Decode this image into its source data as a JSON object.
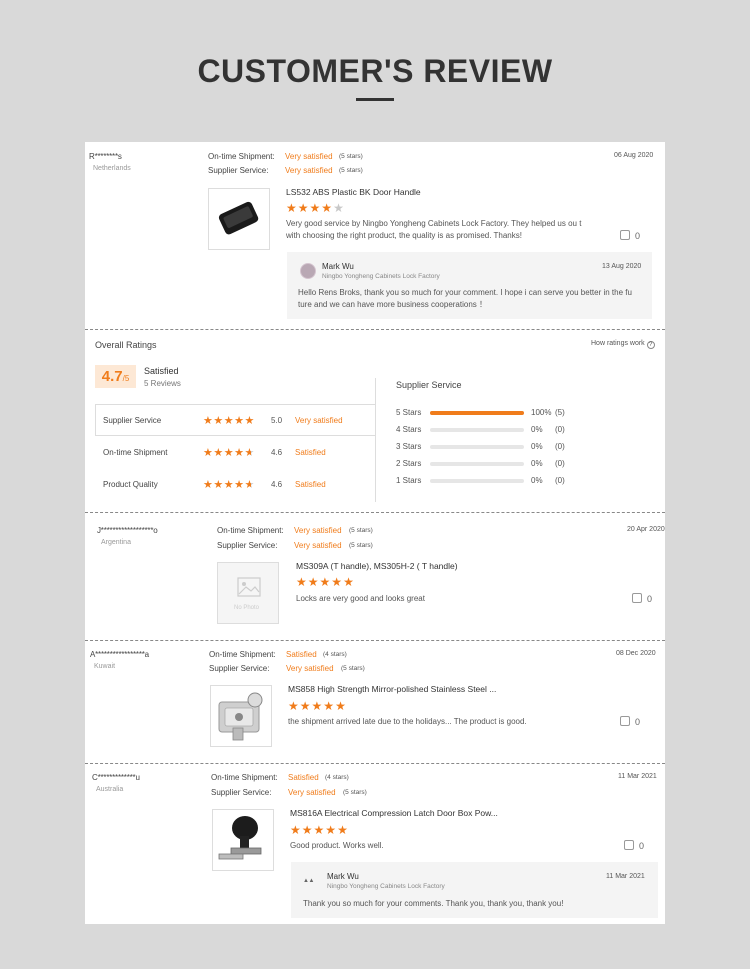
{
  "header": {
    "title": "CUSTOMER'S REVIEW"
  },
  "labels": {
    "ontime": "On-time Shipment:",
    "supplier": "Supplier Service:",
    "like_count": "0"
  },
  "reviews": [
    {
      "name": "R********s",
      "country": "Netherlands",
      "ontime_value": "Very satisfied",
      "ontime_stars": "(5 stars)",
      "supplier_value": "Very satisfied",
      "supplier_stars": "(5 stars)",
      "date": "06 Aug 2020",
      "product": "LS532 ABS Plastic BK Door Handle",
      "rating": 4,
      "text": "Very good service by Ningbo Yongheng Cabinets Lock Factory. They helped us ou t with choosing the right product, the quality is as promised. Thanks!",
      "reply": {
        "name": "Mark Wu",
        "company": "Ningbo Yongheng Cabinets Lock Factory",
        "date": "13 Aug 2020",
        "text": "Hello Rens Broks, thank you so much for your comment. I hope i can serve you better in the fu ture and we can have more business cooperations ！"
      }
    },
    {
      "name": "J******************o",
      "country": "Argentina",
      "ontime_value": "Very satisfied",
      "ontime_stars": "(5 stars)",
      "supplier_value": "Very satisfied",
      "supplier_stars": "(5 stars)",
      "date": "20 Apr 2020",
      "product": "MS309A (T handle), MS305H-2 ( T handle)",
      "rating": 5,
      "text": "Locks are very good and looks great",
      "no_photo": "No Photo"
    },
    {
      "name": "A*****************a",
      "country": "Kuwait",
      "ontime_value": "Satisfied",
      "ontime_stars": "(4 stars)",
      "supplier_value": "Very satisfied",
      "supplier_stars": "(5 stars)",
      "date": "08 Dec 2020",
      "product": "MS858 High Strength Mirror-polished Stainless Steel ...",
      "rating": 5,
      "text": "the shipment arrived late due to the holidays... The product is good."
    },
    {
      "name": "C*************u",
      "country": "Australia",
      "ontime_value": "Satisfied",
      "ontime_stars": "(4 stars)",
      "supplier_value": "Very satisfied",
      "supplier_stars": "(5 stars)",
      "date": "11 Mar 2021",
      "product": "MS816A Electrical Compression Latch Door Box Pow...",
      "rating": 5,
      "text": "Good product. Works well.",
      "reply": {
        "name": "Mark Wu",
        "company": "Ningbo Yongheng Cabinets Lock Factory",
        "date": "11 Mar 2021",
        "text": "Thank you so much for your comments. Thank you, thank you, thank you!"
      }
    }
  ],
  "overall": {
    "title": "Overall Ratings",
    "how_link": "How ratings work",
    "score": "4.7",
    "score_suffix": "/5",
    "status": "Satisfied",
    "count": "5 Reviews",
    "rows": [
      {
        "label": "Supplier Service",
        "score": "5.0",
        "desc": "Very satisfied",
        "value": 5.0
      },
      {
        "label": "On-time Shipment",
        "score": "4.6",
        "desc": "Satisfied",
        "value": 4.6
      },
      {
        "label": "Product Quality",
        "score": "4.6",
        "desc": "Satisfied",
        "value": 4.6
      }
    ],
    "dist_title": "Supplier Service",
    "dist": [
      {
        "label": "5 Stars",
        "pct": "100%",
        "count": "(5)",
        "fraction": 1.0
      },
      {
        "label": "4 Stars",
        "pct": "0%",
        "count": "(0)",
        "fraction": 0
      },
      {
        "label": "3 Stars",
        "pct": "0%",
        "count": "(0)",
        "fraction": 0
      },
      {
        "label": "2 Stars",
        "pct": "0%",
        "count": "(0)",
        "fraction": 0
      },
      {
        "label": "1 Stars",
        "pct": "0%",
        "count": "(0)",
        "fraction": 0
      }
    ]
  },
  "colors": {
    "accent": "#f07c1b",
    "star_empty": "#c8c8c8"
  },
  "icons": {
    "like": "thumbs-up-icon",
    "info": "info-icon",
    "star": "star-icon"
  }
}
